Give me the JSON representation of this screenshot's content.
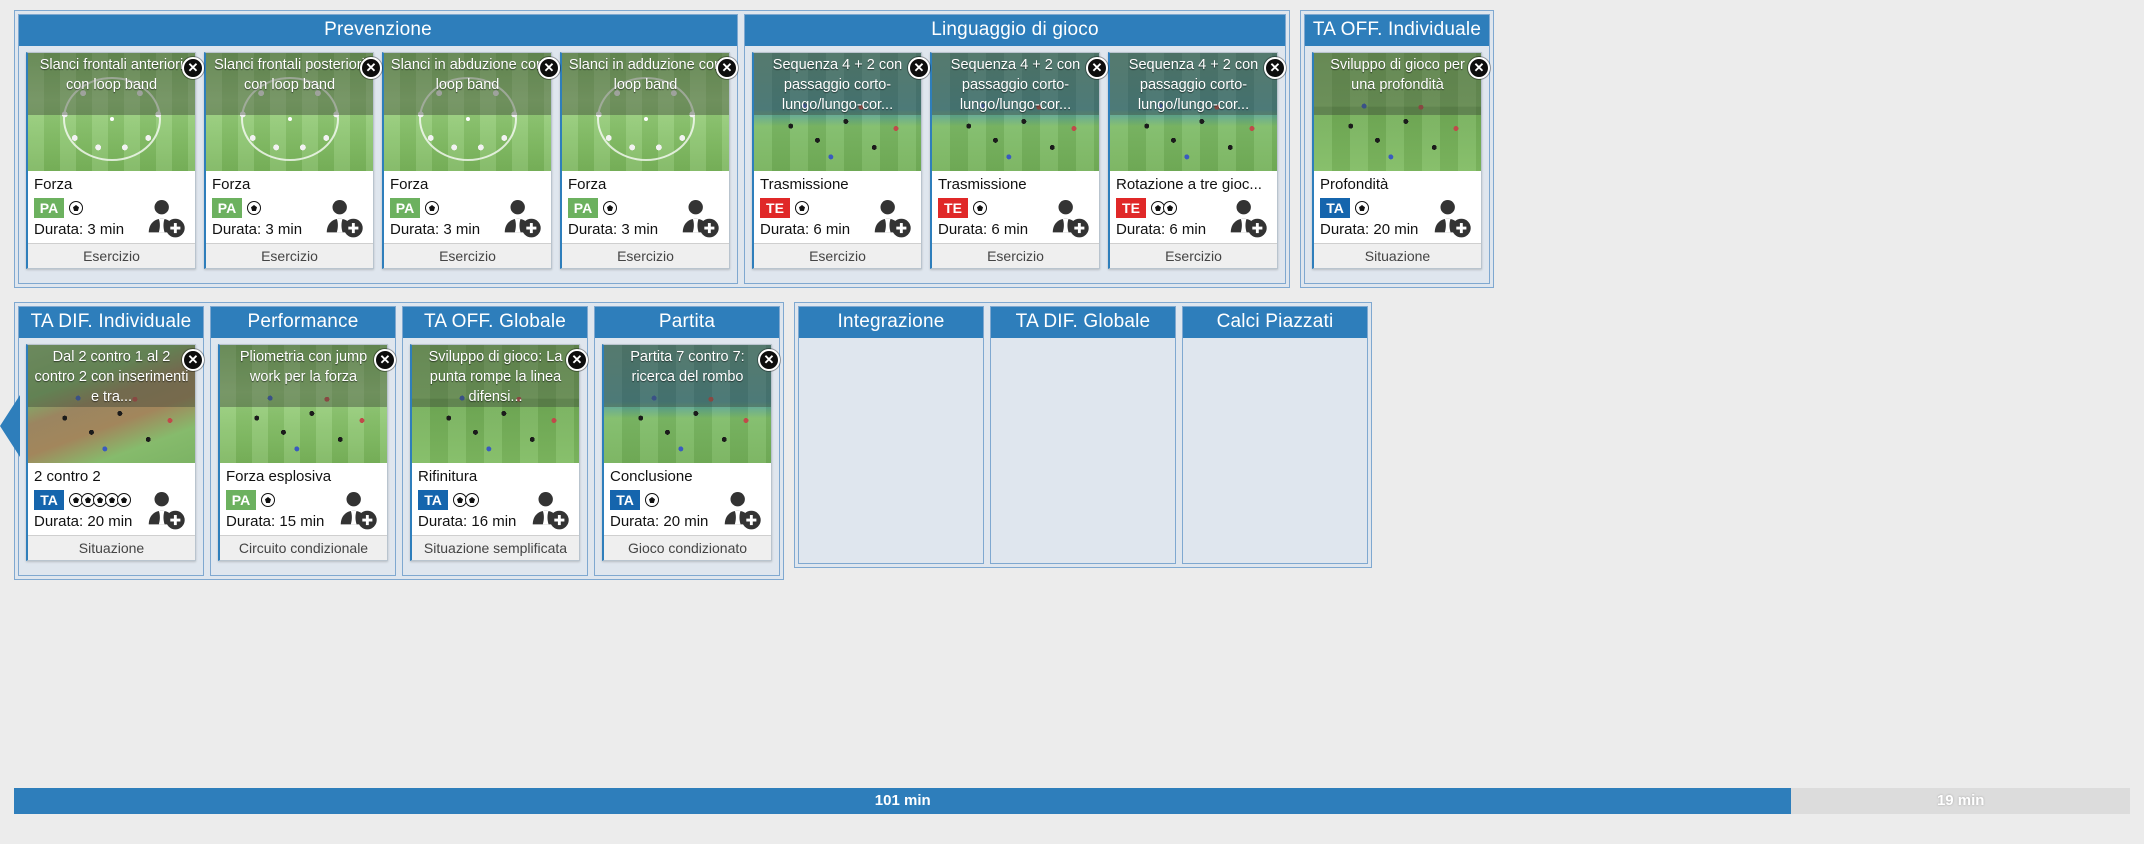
{
  "close_glyph": "✕",
  "progress": {
    "done_label": "101 min",
    "remaining_label": "19 min",
    "done_pct": 84,
    "done_color": "#2e7ebb",
    "remaining_color": "#dcdcdc"
  },
  "tag_colors": {
    "PA": "#6cb15f",
    "TE": "#e02828",
    "TA": "#1565ad"
  },
  "row1": [
    {
      "title": "Prevenzione",
      "cards": [
        {
          "title": "Slanci frontali anteriori con loop band",
          "objective": "Forza",
          "tag": "PA",
          "balls": 1,
          "duration": "Durata: 3 min",
          "type": "Esercizio",
          "pitch": "light",
          "figure": "circle"
        },
        {
          "title": "Slanci frontali posteriori con loop band",
          "objective": "Forza",
          "tag": "PA",
          "balls": 1,
          "duration": "Durata: 3 min",
          "type": "Esercizio",
          "pitch": "light",
          "figure": "circle"
        },
        {
          "title": "Slanci in abduzione con loop band",
          "objective": "Forza",
          "tag": "PA",
          "balls": 1,
          "duration": "Durata: 3 min",
          "type": "Esercizio",
          "pitch": "light",
          "figure": "circle"
        },
        {
          "title": "Slanci in adduzione con loop band",
          "objective": "Forza",
          "tag": "PA",
          "balls": 1,
          "duration": "Durata: 3 min",
          "type": "Esercizio",
          "pitch": "light",
          "figure": "circle"
        }
      ]
    },
    {
      "title": "Linguaggio di gioco",
      "cards": [
        {
          "title": "Sequenza 4 + 2 con passaggio corto-lungo/lungo-cor...",
          "objective": "Trasmissione",
          "tag": "TE",
          "balls": 1,
          "duration": "Durata: 6 min",
          "type": "Esercizio",
          "pitch": "teal",
          "figure": "dots"
        },
        {
          "title": "Sequenza 4 + 2 con passaggio corto-lungo/lungo-cor...",
          "objective": "Trasmissione",
          "tag": "TE",
          "balls": 1,
          "duration": "Durata: 6 min",
          "type": "Esercizio",
          "pitch": "teal",
          "figure": "dots"
        },
        {
          "title": "Sequenza 4 + 2 con passaggio corto-lungo/lungo-cor...",
          "objective": "Rotazione a tre gioc...",
          "tag": "TE",
          "balls": 2,
          "duration": "Durata: 6 min",
          "type": "Esercizio",
          "pitch": "teal",
          "figure": "dots"
        }
      ]
    },
    {
      "title": "TA OFF. Individuale",
      "cards": [
        {
          "title": "Sviluppo di gioco per una profondità",
          "objective": "Profondità",
          "tag": "TA",
          "balls": 1,
          "duration": "Durata: 20 min",
          "type": "Situazione",
          "pitch": "full",
          "figure": "dots"
        }
      ]
    }
  ],
  "row2": [
    {
      "title": "TA DIF. Individuale",
      "cards": [
        {
          "title": "Dal 2 contro 1 al 2 contro 2 con inserimenti e tra...",
          "objective": "2 contro 2",
          "tag": "TA",
          "balls": 5,
          "duration": "Durata: 20 min",
          "type": "Situazione",
          "pitch": "brown",
          "figure": "dots"
        }
      ]
    },
    {
      "title": "Performance",
      "cards": [
        {
          "title": "Pliometria con jump work per la forza",
          "objective": "Forza esplosiva",
          "tag": "PA",
          "balls": 1,
          "duration": "Durata: 15 min",
          "type": "Circuito condizionale",
          "pitch": "light",
          "figure": "dots"
        }
      ]
    },
    {
      "title": "TA OFF. Globale",
      "cards": [
        {
          "title": "Sviluppo di gioco: La punta rompe la linea difensi...",
          "objective": "Rifinitura",
          "tag": "TA",
          "balls": 2,
          "duration": "Durata: 16 min",
          "type": "Situazione semplificata",
          "pitch": "full",
          "figure": "dots"
        }
      ]
    },
    {
      "title": "Partita",
      "cards": [
        {
          "title": "Partita 7 contro 7: ricerca del rombo",
          "objective": "Conclusione",
          "tag": "TA",
          "balls": 1,
          "duration": "Durata: 20 min",
          "type": "Gioco condizionato",
          "pitch": "teal",
          "figure": "dots"
        }
      ]
    },
    {
      "title": "Integrazione",
      "cards": []
    },
    {
      "title": "TA DIF. Globale",
      "cards": []
    },
    {
      "title": "Calci Piazzati",
      "cards": []
    }
  ]
}
